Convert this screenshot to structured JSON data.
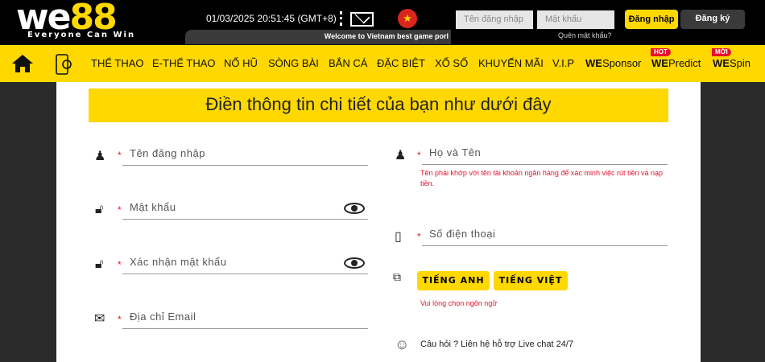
{
  "header": {
    "logo_we": "we",
    "logo_88": "88",
    "tagline": "Everyone Can Win",
    "datetime": "01/03/2025 20:51:45  (GMT+8)",
    "username_placeholder": "Tên đăng nhập",
    "password_placeholder": "Mật khẩu",
    "login": "Đăng nhập",
    "register": "Đăng ký",
    "ticker": "Welcome to Vietnam best game porl",
    "forgot": "Quên mật khẩu?",
    "flag": "★"
  },
  "nav": {
    "items": [
      "THỂ THAO",
      "E-THỂ THAO",
      "NỔ HŨ",
      "SÒNG BÀI",
      "BẮN CÁ",
      "ĐẶC BIỆT",
      "XỔ SỐ",
      "KHUYẾN MÃI",
      "V.I.P"
    ],
    "we": "WE",
    "sponsor": "Sponsor",
    "predict": "Predict",
    "spin": "Spin",
    "hot": "HOT",
    "new": "MỚI"
  },
  "form": {
    "title": "Điền thông tin chi tiết của bạn như dưới đây",
    "required": "*",
    "username": "Tên đăng nhập",
    "password": "Mật khẩu",
    "confirm": "Xác nhận mật khẩu",
    "email": "Địa chỉ Email",
    "fullname": "Họ và Tên",
    "fullname_hint": "Tên phải khớp với tên tài khoản ngân hàng để xác minh việc rút tiền và nạp tiền.",
    "phone": "Số điện thoại",
    "lang_en": "TIẾNG ANH",
    "lang_vi": "TIẾNG VIỆT",
    "lang_hint": "Vui lòng chọn ngôn ngữ",
    "support": "Câu hỏi ? Liên hệ hỗ trợ Live chat 24/7"
  },
  "colors": {
    "brand": "#ffd800",
    "error": "#e8102a"
  }
}
